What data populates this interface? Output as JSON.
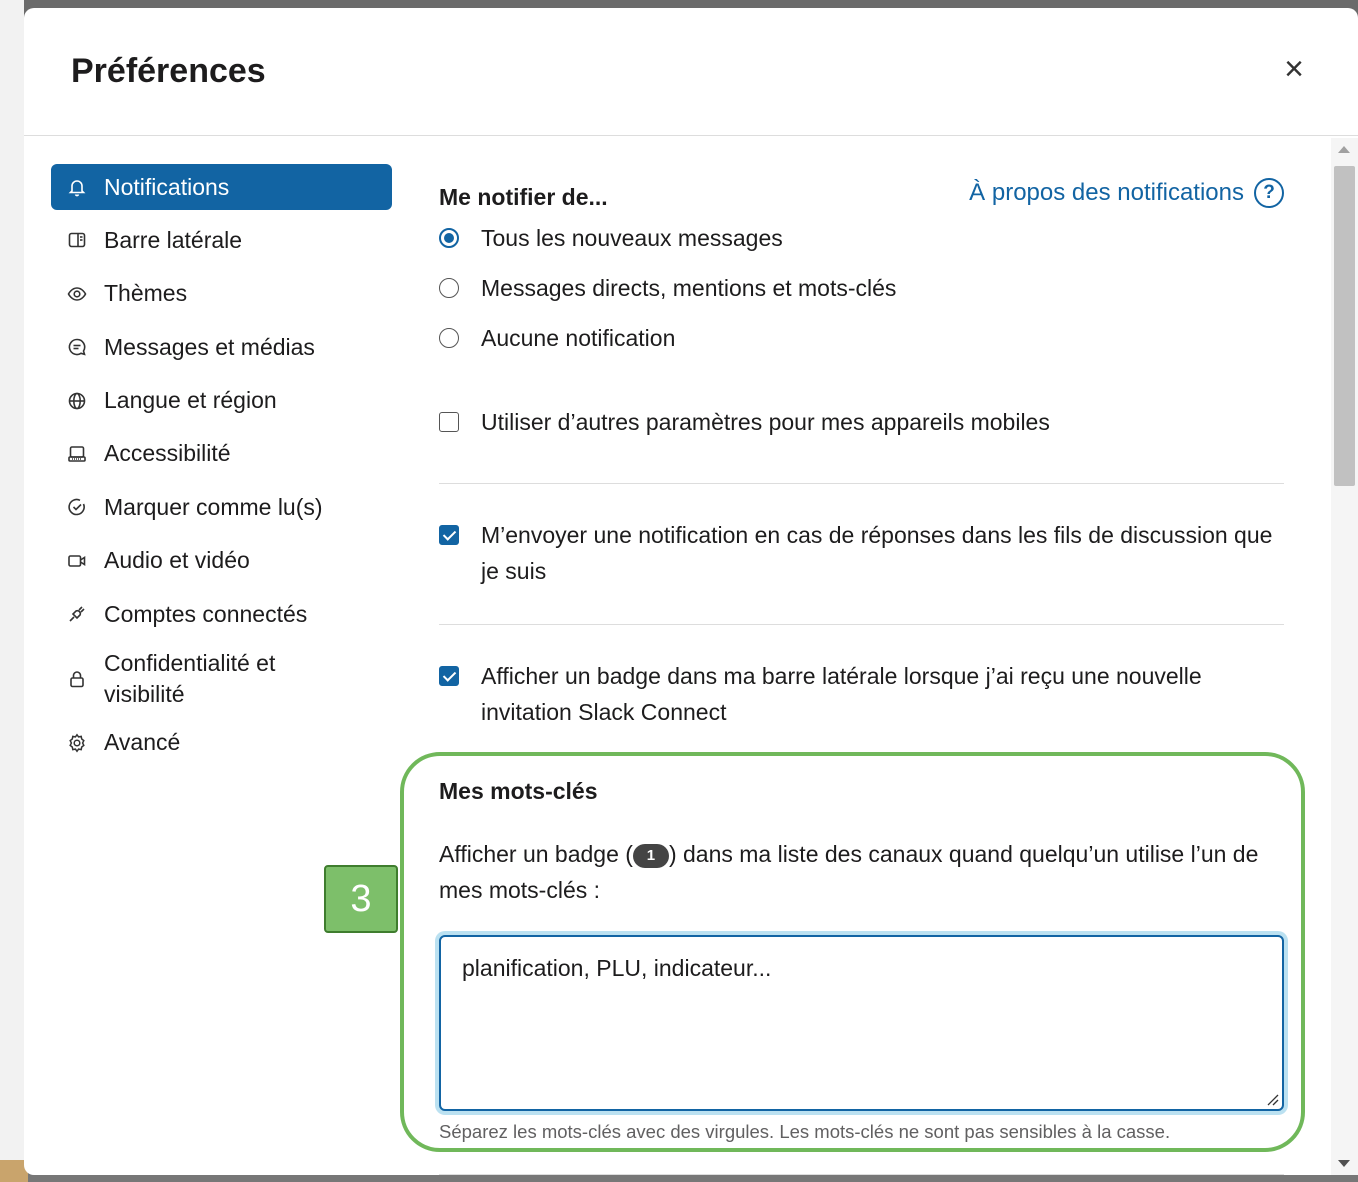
{
  "modal": {
    "title": "Préférences",
    "close_symbol": "×"
  },
  "sidebar": {
    "items": [
      {
        "label": "Notifications",
        "icon": "bell-icon",
        "active": true
      },
      {
        "label": "Barre latérale",
        "icon": "sidebar-icon"
      },
      {
        "label": "Thèmes",
        "icon": "eye-icon"
      },
      {
        "label": "Messages et médias",
        "icon": "message-icon"
      },
      {
        "label": "Langue et région",
        "icon": "globe-icon"
      },
      {
        "label": "Accessibilité",
        "icon": "keyboard-icon"
      },
      {
        "label": "Marquer comme lu(s)",
        "icon": "check-circle-icon"
      },
      {
        "label": "Audio et vidéo",
        "icon": "video-icon"
      },
      {
        "label": "Comptes connectés",
        "icon": "plug-icon"
      },
      {
        "label": "Confidentialité et visibilité",
        "icon": "lock-icon"
      },
      {
        "label": "Avancé",
        "icon": "gear-icon"
      }
    ]
  },
  "notify": {
    "title": "Me notifier de...",
    "help_link": "À propos des notifications",
    "help_icon": "?",
    "options": [
      {
        "label": "Tous les nouveaux messages",
        "selected": true
      },
      {
        "label": "Messages directs, mentions et mots-clés",
        "selected": false
      },
      {
        "label": "Aucune notification",
        "selected": false
      }
    ]
  },
  "checkboxes": {
    "mobile": {
      "label": "Utiliser d’autres paramètres pour mes appareils mobiles",
      "checked": false
    },
    "threads": {
      "label": "M’envoyer une notification en cas de réponses dans les fils de discussion que je suis",
      "checked": true
    },
    "slack_connect": {
      "label": "Afficher un badge dans ma barre latérale lorsque j’ai reçu une nouvelle invitation Slack Connect",
      "checked": true
    }
  },
  "keywords": {
    "title": "Mes mots-clés",
    "desc_before": "Afficher un badge (",
    "badge": "1",
    "desc_after": ") dans ma liste des canaux quand quelqu’un utilise l’un de mes mots-clés :",
    "value": "planification, PLU, indicateur...",
    "hint": "Séparez les mots-clés avec des virgules. Les mots-clés ne sont pas sensibles à la casse."
  },
  "annotation": {
    "step": "3",
    "color": "#70b85a"
  },
  "colors": {
    "accent": "#1264a3",
    "text": "#1d1c1d",
    "muted": "#616061"
  }
}
